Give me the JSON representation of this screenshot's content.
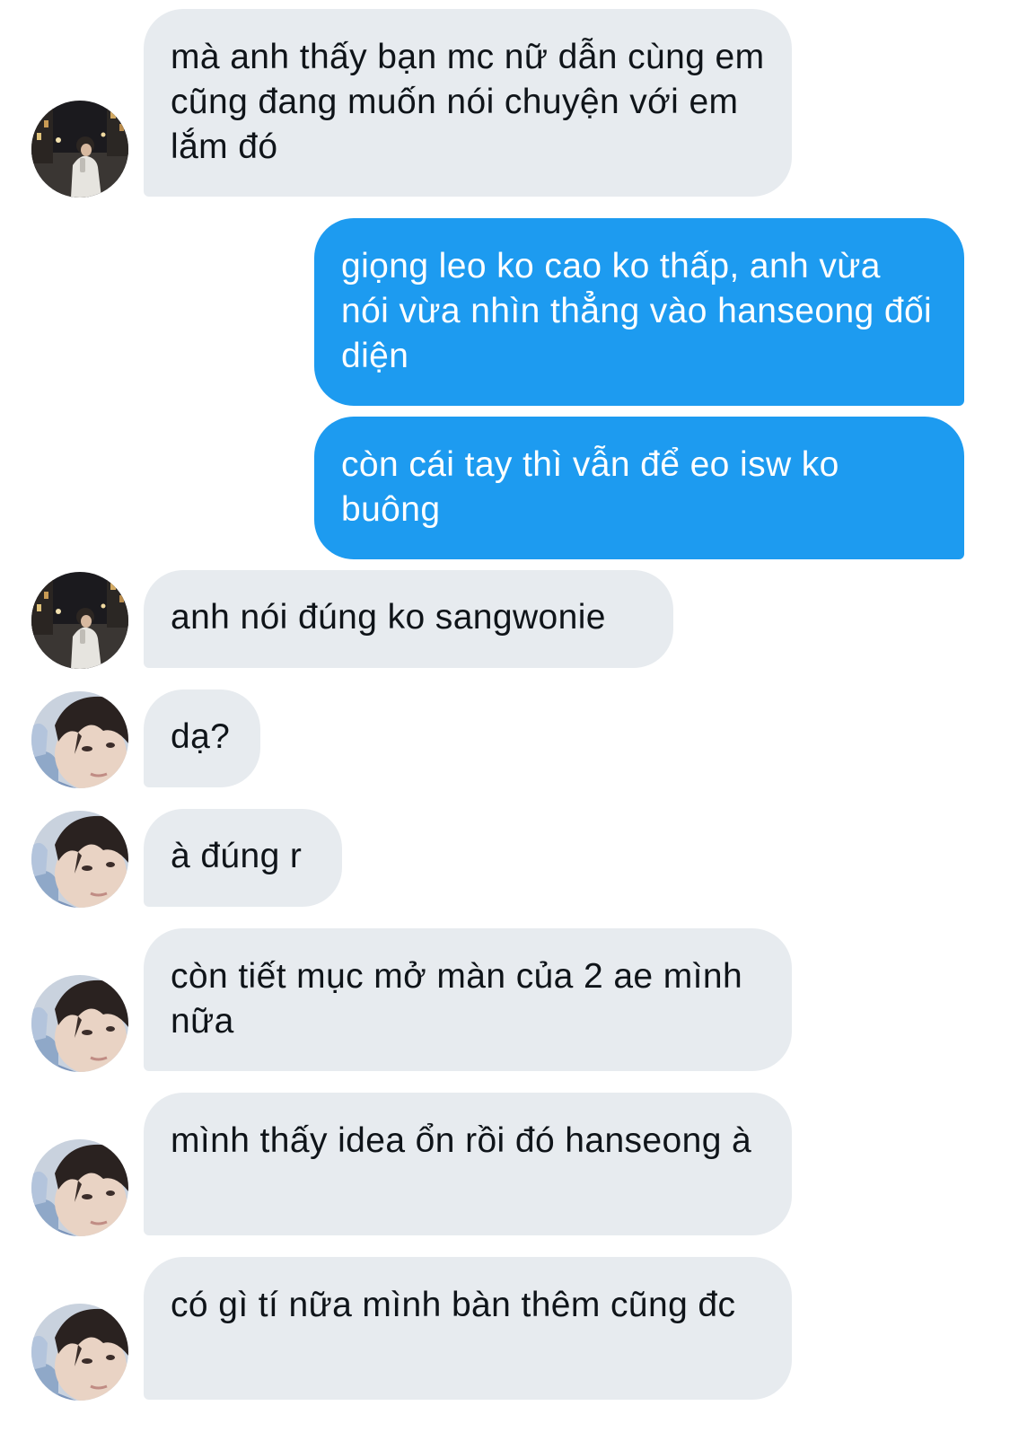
{
  "conversation": {
    "messages": [
      {
        "side": "received",
        "sender": "A",
        "text": "mà anh thấy bạn mc nữ dẫn cùng em cũng đang muốn nói chuyện với em lắm đó"
      },
      {
        "side": "sent",
        "text": "giọng leo ko cao ko thấp, anh vừa nói vừa nhìn thẳng vào hanseong đối diện"
      },
      {
        "side": "sent",
        "text": "còn cái tay thì vẫn để eo isw ko buông"
      },
      {
        "side": "received",
        "sender": "A",
        "text": "anh nói đúng ko sangwonie"
      },
      {
        "side": "received",
        "sender": "B",
        "text": "dạ?"
      },
      {
        "side": "received",
        "sender": "B",
        "text": "à đúng r"
      },
      {
        "side": "received",
        "sender": "B",
        "text": "còn tiết mục mở màn của 2 ae mình nữa"
      },
      {
        "side": "received",
        "sender": "B",
        "text": "mình thấy idea ổn rồi đó hanseong à"
      },
      {
        "side": "received",
        "sender": "B",
        "text": "có gì tí nữa mình bàn thêm cũng đc"
      }
    ]
  },
  "colors": {
    "received_bubble": "#e7ebef",
    "received_text": "#0f1419",
    "sent_bubble": "#1d9bf0",
    "sent_text": "#ffffff",
    "background": "#ffffff"
  },
  "icons": {
    "avatar_a": "avatar-photo-night-street",
    "avatar_b": "avatar-photo-selfie"
  }
}
